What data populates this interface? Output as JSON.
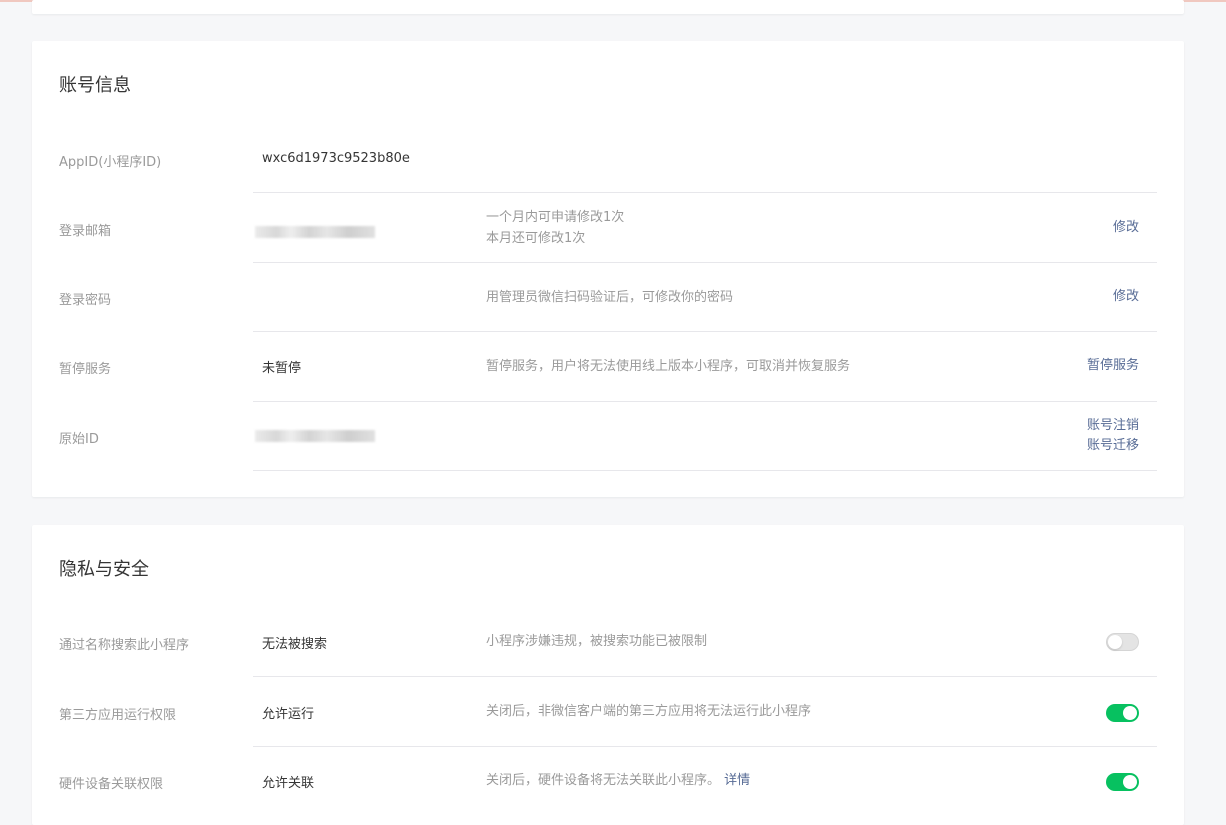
{
  "colors": {
    "accent_link": "#576b95",
    "toggle_on": "#07c160",
    "toggle_off": "#e4e4e4"
  },
  "account": {
    "title": "账号信息",
    "appid": {
      "label": "AppID(小程序ID)",
      "value": "wxc6d1973c9523b80e"
    },
    "email": {
      "label": "登录邮箱",
      "desc_line1": "一个月内可申请修改1次",
      "desc_line2": "本月还可修改1次",
      "action": "修改"
    },
    "password": {
      "label": "登录密码",
      "desc": "用管理员微信扫码验证后，可修改你的密码",
      "action": "修改"
    },
    "pause": {
      "label": "暂停服务",
      "value": "未暂停",
      "desc": "暂停服务，用户将无法使用线上版本小程序，可取消并恢复服务",
      "action": "暂停服务"
    },
    "original_id": {
      "label": "原始ID",
      "action1": "账号注销",
      "action2": "账号迁移"
    }
  },
  "privacy": {
    "title": "隐私与安全",
    "search": {
      "label": "通过名称搜索此小程序",
      "value": "无法被搜索",
      "desc": "小程序涉嫌违规，被搜索功能已被限制",
      "toggle": "off"
    },
    "third_party": {
      "label": "第三方应用运行权限",
      "value": "允许运行",
      "desc": "关闭后，非微信客户端的第三方应用将无法运行此小程序",
      "toggle": "on"
    },
    "hardware": {
      "label": "硬件设备关联权限",
      "value": "允许关联",
      "desc": "关闭后，硬件设备将无法关联此小程序。",
      "link": "详情",
      "toggle": "on"
    }
  }
}
